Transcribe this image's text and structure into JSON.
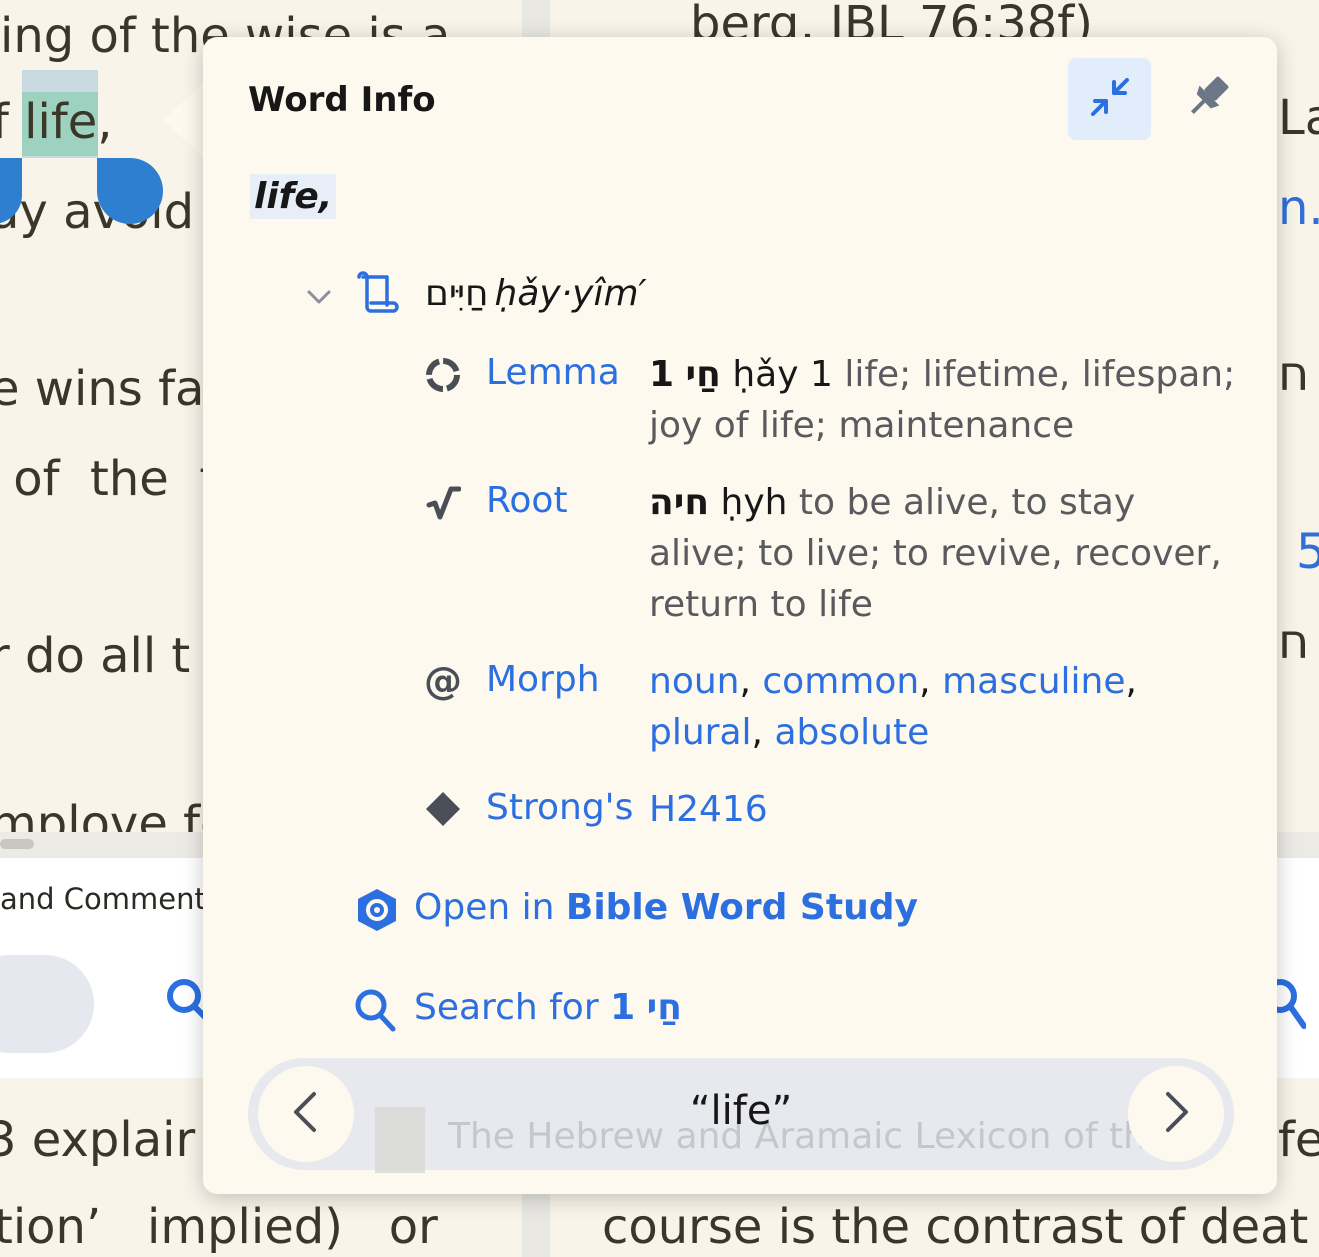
{
  "background": {
    "left_lines": [
      "ing of the wise is a",
      "f life,",
      "ay avoid",
      "e wins fa",
      " of  the  t",
      "r do all t",
      "mplove fo",
      "3  explair",
      "tion’   implied)   or"
    ],
    "right_lines": [
      "berg, JBL 76:38f)",
      "La",
      "n.",
      "ח",
      "5",
      "ח",
      "fe,",
      "course is the contrast of deat"
    ],
    "pane_title": "and Commenta"
  },
  "popup": {
    "title": "Word Info",
    "word": "life,",
    "hebrew_head": "חַיִּים",
    "translit": "ḥǎy·yîm′",
    "rows": {
      "lemma": {
        "label": "Lemma",
        "num": "1",
        "heb": "חַי",
        "translit": "ḥǎy",
        "num2": "1",
        "gloss": "life; lifetime, lifespan; joy of life; maintenance"
      },
      "root": {
        "label": "Root",
        "heb": "חיה",
        "translit": "ḥyh",
        "gloss": "to be alive, to stay alive; to live; to revive, recover, return to life"
      },
      "morph": {
        "label": "Morph",
        "items": [
          "noun",
          "common",
          "masculine",
          "plural",
          "absolute"
        ]
      },
      "strongs": {
        "label": "Strong's",
        "value": "H2416"
      }
    },
    "open": {
      "prefix": "Open in",
      "target": "Bible Word Study"
    },
    "search": {
      "prefix": "Search for",
      "num": "1",
      "heb": "חַי"
    },
    "footer": {
      "word": "“life”",
      "ghost": "The Hebrew and Aramaic Lexicon of th..."
    }
  },
  "colors": {
    "accent": "#2b6fe0",
    "popup_bg": "#fdf9ee",
    "page_bg": "#f8f4ea"
  },
  "icons": {
    "collapse": "collapse-arrows-icon",
    "pin": "pin-icon",
    "chevron": "chevron-down-icon",
    "scroll": "scroll-icon",
    "lemma": "lemma-circle-icon",
    "root": "root-sqrt-icon",
    "morph": "at-sign-icon",
    "strongs": "diamond-icon",
    "open": "word-study-hexagon-icon",
    "search": "search-icon",
    "prev": "chevron-left-icon",
    "next": "chevron-right-icon"
  }
}
